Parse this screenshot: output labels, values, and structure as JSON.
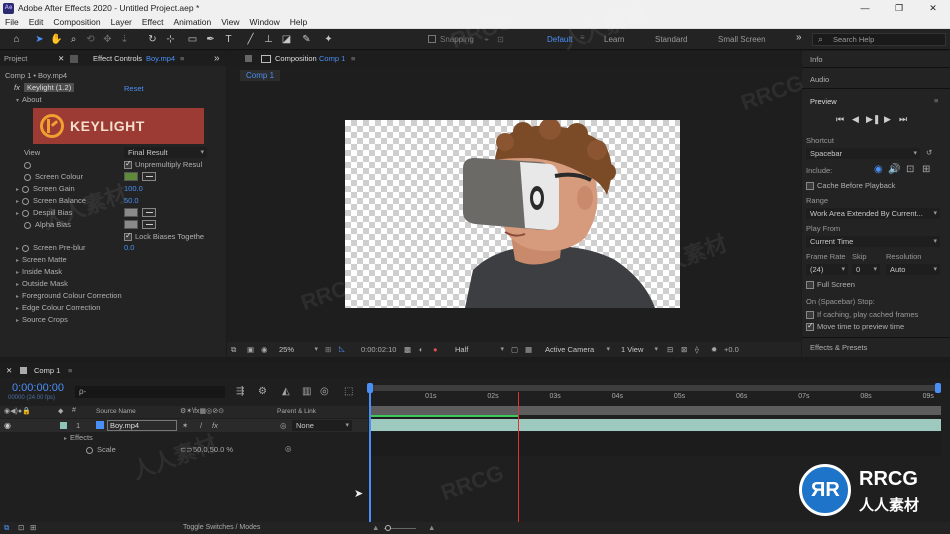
{
  "window": {
    "title": "Adobe After Effects 2020 - Untitled Project.aep *",
    "app_badge": "Ae",
    "controls": [
      "—",
      "❐",
      "✕"
    ]
  },
  "menu": [
    "File",
    "Edit",
    "Composition",
    "Layer",
    "Effect",
    "Animation",
    "View",
    "Window",
    "Help"
  ],
  "toolbar": {
    "snapping": "Snapping",
    "workspaces": [
      "Default",
      "Learn",
      "Standard",
      "Small Screen"
    ],
    "active_workspace": "Default",
    "more": "»",
    "search_placeholder": "Search Help"
  },
  "project_tab": "Project",
  "effect_controls": {
    "tab_label": "Effect Controls",
    "tab_layer": "Boy.mp4",
    "breadcrumb": "Comp 1 • Boy.mp4",
    "effect_name": "Keylight (1.2)",
    "reset": "Reset",
    "about": "About",
    "logo_text": "KEYLIGHT",
    "view_label": "View",
    "view_value": "Final Result",
    "unpremultiply": "Unpremultiply Resul",
    "screen_colour": "Screen Colour",
    "screen_gain": "Screen Gain",
    "screen_gain_value": "100.0",
    "screen_balance": "Screen Balance",
    "screen_balance_value": "50.0",
    "despill_bias": "Despill Bias",
    "alpha_bias": "Alpha Bias",
    "lock_biases": "Lock Biases Togethe",
    "screen_preblur": "Screen Pre-blur",
    "screen_preblur_value": "0.0",
    "groups": [
      "Screen Matte",
      "Inside Mask",
      "Outside Mask",
      "Foreground Colour Correction",
      "Edge Colour Correction",
      "Source Crops"
    ],
    "screen_colour_hex": "#5e8a3a"
  },
  "composition": {
    "tab_label": "Composition",
    "tab_comp": "Comp 1",
    "sub_tab": "Comp 1",
    "zoom": "25%",
    "timecode": "0:00:02:10",
    "resolution": "Half",
    "camera": "Active Camera",
    "views": "1 View",
    "exposure": "+0.0"
  },
  "right_panel": {
    "info": "Info",
    "audio": "Audio",
    "preview": "Preview",
    "shortcut_label": "Shortcut",
    "shortcut_value": "Spacebar",
    "include_label": "Include:",
    "cache_before": "Cache Before Playback",
    "range_label": "Range",
    "range_value": "Work Area Extended By Current...",
    "play_from_label": "Play From",
    "play_from_value": "Current Time",
    "frame_rate_label": "Frame Rate",
    "skip_label": "Skip",
    "resolution_label": "Resolution",
    "frame_rate_value": "(24)",
    "skip_value": "0",
    "resolution_value": "Auto",
    "full_screen": "Full Screen",
    "on_stop": "On (Spacebar) Stop:",
    "if_caching": "If caching, play cached frames",
    "move_time": "Move time to preview time",
    "effects_presets": "Effects & Presets"
  },
  "timeline": {
    "tab": "Comp 1",
    "timecode": "0:00:00:00",
    "timecode_sub": "00000 (24.00 fps)",
    "search_icon_text": "ρ-",
    "col_source": "Source Name",
    "col_parent": "Parent & Link",
    "layer_num": "1",
    "layer_name": "Boy.mp4",
    "parent_value": "None",
    "effects_label": "Effects",
    "scale_label": "Scale",
    "scale_value": "50.0,50.0 %",
    "toggle_label": "Toggle Switches / Modes",
    "ruler": [
      "01s",
      "02s",
      "03s",
      "04s",
      "05s",
      "06s",
      "07s",
      "08s",
      "09s"
    ],
    "playhead_seconds": 2.4,
    "duration_seconds": 9.2
  },
  "watermarks": [
    "RRCG",
    "人人素材"
  ],
  "brand_badge": {
    "top": "RRCG",
    "bottom": "人人素材"
  }
}
